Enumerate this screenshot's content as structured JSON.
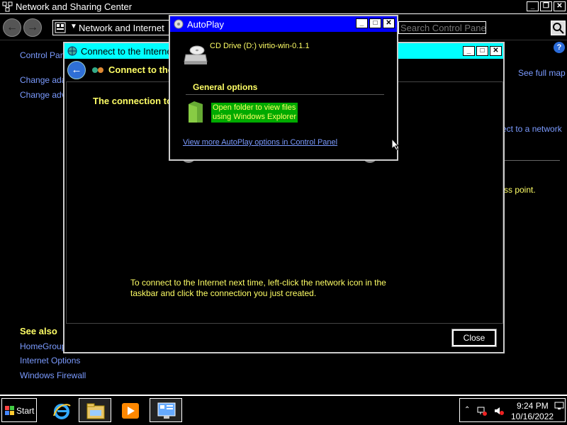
{
  "main_window": {
    "title": "Network and Sharing Center",
    "breadcrumb": "Network and Internet",
    "search_placeholder": "Search Control Panel",
    "left_links": [
      "Control Panel Home",
      "Change adapter settings",
      "Change advanced sharing settings"
    ],
    "see_also_heading": "See also",
    "see_also_links": [
      "HomeGroup",
      "Internet Options",
      "Windows Firewall"
    ],
    "right_link_map": "See full map",
    "right_text_connect": "ect to a network",
    "right_text_access": "ss point."
  },
  "dialog": {
    "title": "Connect to the Internet",
    "subtitle": "Connect to the Internet",
    "heading": "The connection to the Internet is ready to use",
    "info": "To connect to the Internet next time, left-click the network icon in the taskbar and click the connection you just created.",
    "close_label": "Close"
  },
  "autoplay": {
    "title": "AutoPlay",
    "drive_label": "CD Drive (D:) virtio-win-0.1.1",
    "section": "General options",
    "option_line1": "Open folder to view files",
    "option_line2": "using Windows Explorer",
    "more_link": "View more AutoPlay options in Control Panel"
  },
  "taskbar": {
    "start_label": "Start",
    "apps": [
      "internet-explorer-icon",
      "windows-explorer-icon",
      "media-player-icon",
      "control-panel-icon"
    ],
    "time": "9:24 PM",
    "date": "10/16/2022"
  },
  "colors": {
    "dialog_title_bg": "#00ffff",
    "autoplay_title_bg": "#0000ff",
    "link": "#7b9bff",
    "highlight_text": "#ffff66",
    "selected_option_bg": "#00aa00"
  }
}
